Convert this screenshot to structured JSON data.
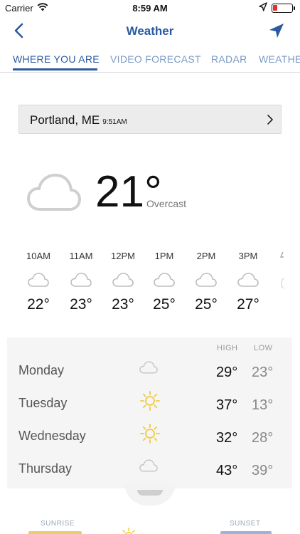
{
  "status_bar": {
    "carrier": "Carrier",
    "time": "8:59 AM"
  },
  "nav": {
    "title": "Weather"
  },
  "tabs": [
    {
      "label": "WHERE YOU ARE",
      "active": true
    },
    {
      "label": "VIDEO FORECAST",
      "active": false
    },
    {
      "label": "RADAR",
      "active": false
    },
    {
      "label": "WEATHE",
      "active": false
    }
  ],
  "location": {
    "city": "Portland, ME",
    "updated_time": "9:51AM"
  },
  "current": {
    "temperature": "21°",
    "condition": "Overcast",
    "icon": "cloud-icon"
  },
  "hourly": [
    {
      "time": "10AM",
      "icon": "cloud-icon",
      "temp": "22°"
    },
    {
      "time": "11AM",
      "icon": "cloud-icon",
      "temp": "23°"
    },
    {
      "time": "12PM",
      "icon": "cloud-icon",
      "temp": "23°"
    },
    {
      "time": "1PM",
      "icon": "cloud-icon",
      "temp": "25°"
    },
    {
      "time": "2PM",
      "icon": "cloud-icon",
      "temp": "25°"
    },
    {
      "time": "3PM",
      "icon": "cloud-icon",
      "temp": "27°"
    }
  ],
  "daily": {
    "high_header": "HIGH",
    "low_header": "LOW",
    "days": [
      {
        "name": "Monday",
        "icon": "cloud-icon",
        "high": "29°",
        "low": "23°"
      },
      {
        "name": "Tuesday",
        "icon": "sun-icon",
        "high": "37°",
        "low": "13°"
      },
      {
        "name": "Wednesday",
        "icon": "sun-icon",
        "high": "32°",
        "low": "28°"
      },
      {
        "name": "Thursday",
        "icon": "cloud-icon",
        "high": "43°",
        "low": "39°"
      }
    ]
  },
  "sun": {
    "sunrise_label": "SUNRISE",
    "sunset_label": "SUNSET"
  },
  "colors": {
    "accent": "#2b5aa0",
    "tab_inactive": "#7a9ac4",
    "sun": "#f0cb3c",
    "cloud": "#cfcfcf"
  }
}
